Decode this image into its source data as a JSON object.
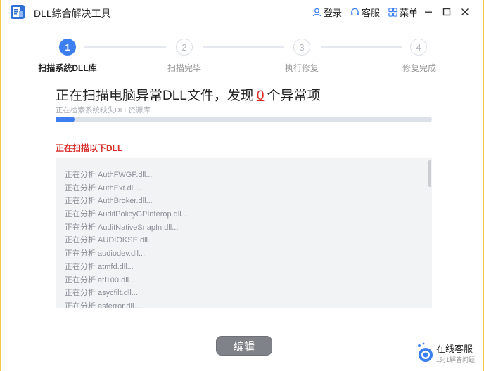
{
  "window": {
    "title": "DLL综合解决工具",
    "login_label": "登录",
    "service_label": "客服",
    "menu_label": "菜单"
  },
  "steps": [
    {
      "number": "1",
      "label": "扫描系统DLL库",
      "state": "active"
    },
    {
      "number": "2",
      "label": "扫描完毕",
      "state": "inactive"
    },
    {
      "number": "3",
      "label": "执行修复",
      "state": "inactive"
    },
    {
      "number": "4",
      "label": "修复完成",
      "state": "inactive"
    }
  ],
  "scan": {
    "headline_prefix": "正在扫描电脑异常DLL文件，发现",
    "found_count": "0",
    "headline_suffix": "个异常项",
    "subline": "正在检索系统缺失DLL资源库...",
    "progress_percent": 5,
    "section_label": "正在扫描以下DLL"
  },
  "log_items": [
    "正在分析 AuthFWGP.dll...",
    "正在分析 AuthExt.dll...",
    "正在分析 AuthBroker.dll...",
    "正在分析 AuditPolicyGPInterop.dll...",
    "正在分析 AuditNativeSnapIn.dll...",
    "正在分析 AUDIOKSE.dll...",
    "正在分析 audiodev.dll...",
    "正在分析 atmfd.dll...",
    "正在分析 atl100.dll...",
    "正在分析 asycfilt.dll...",
    "正在分析 asferror.dll..."
  ],
  "bottom": {
    "edit_label": "编辑",
    "support_title": "在线客服",
    "support_sub": "1对1解答问题"
  },
  "colors": {
    "accent": "#3d7ef0",
    "alert": "#d9302c",
    "frame": "#f2c94c"
  }
}
